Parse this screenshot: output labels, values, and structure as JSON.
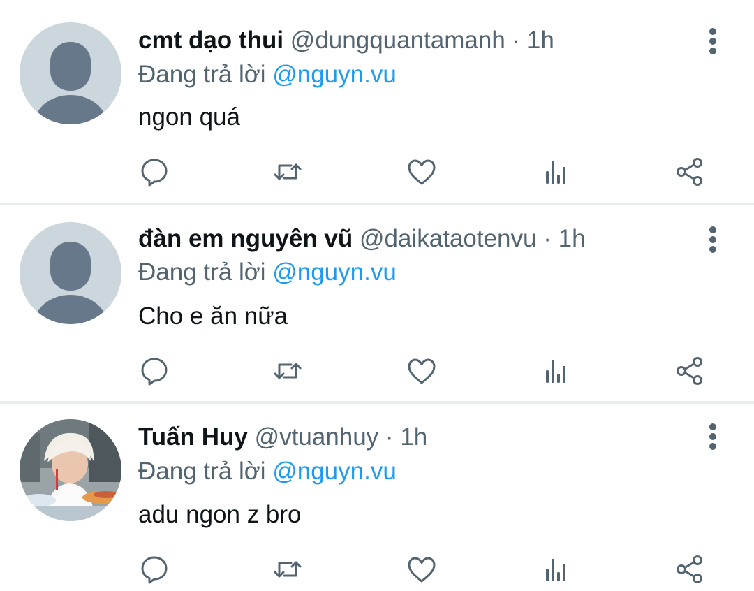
{
  "reply_prefix": "Đang trả lời",
  "separator": "·",
  "colors": {
    "text": "#0f1419",
    "muted": "#536471",
    "mention": "#1d9bf0",
    "divider": "#e8ecef",
    "avatar_placeholder": "#ccd6dd"
  },
  "icons": [
    "reply-icon",
    "retweet-icon",
    "like-icon",
    "views-icon",
    "share-icon",
    "more-icon"
  ],
  "tweets": [
    {
      "name": "cmt dạo thui",
      "handle": "@dungquantamanh",
      "time": "1h",
      "reply_to": "@nguyn.vu",
      "text": "ngon quá",
      "avatar": "default"
    },
    {
      "name": "đàn em nguyên vũ",
      "handle": "@daikataotenvu",
      "time": "1h",
      "reply_to": "@nguyn.vu",
      "text": "Cho e ăn nữa",
      "avatar": "default"
    },
    {
      "name": "Tuấn Huy",
      "handle": "@vtuanhuy",
      "time": "1h",
      "reply_to": "@nguyn.vu",
      "text": "adu ngon z bro",
      "avatar": "photo"
    }
  ]
}
